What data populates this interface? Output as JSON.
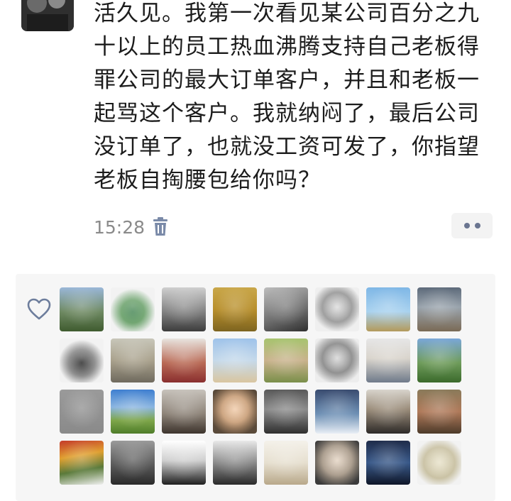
{
  "post": {
    "text_lines": [
      "活久见。我第一次看见某公司百分之九",
      "十以上的员工热血沸腾支持自己老板得",
      "罪公司的最大订单客户，并且和老板一",
      "起骂这个客户。我就纳闷了，最后公司",
      "没订单了，也就没工资可发了，你指望",
      "老板自掏腰包给你吗？"
    ],
    "timestamp": "15:28"
  },
  "icons": {
    "delete": "trash-icon",
    "more": "more-dots-icon",
    "like": "heart-outline-icon"
  },
  "colors": {
    "text": "#1c1c1c",
    "timestamp": "#8a8a8a",
    "panel_bg": "#f6f6f6",
    "dots": "#6a7590"
  },
  "likers": [
    {
      "bg": "linear-gradient(180deg,#9ab7d8 0%,#6f8a63 55%,#3f5b2f 100%)"
    },
    {
      "bg": "radial-gradient(circle at 50% 55%,#4c8a5a 0%,#6da36d 35%,#f2f2f2 70%)"
    },
    {
      "bg": "linear-gradient(180deg,#cfcfcf 0%,#7b7b7b 60%,#3c3c3c 100%)"
    },
    {
      "bg": "linear-gradient(180deg,#c9a74a 0%,#b88f2c 50%,#7d6420 100%)"
    },
    {
      "bg": "linear-gradient(160deg,#bdbdbd 0%,#6d6d6d 60%,#2f2f2f 100%)"
    },
    {
      "bg": "radial-gradient(circle at 50% 45%,#dcdcdc 0%,#9a9a9a 45%,#efefef 75%)"
    },
    {
      "bg": "linear-gradient(180deg,#7fb7e6 0%,#a9d2ef 55%,#b39a5b 100%)"
    },
    {
      "bg": "linear-gradient(180deg,#5d6a7a 0%,#9aa4ad 45%,#7a6a55 100%)"
    },
    {
      "bg": "radial-gradient(circle at 50% 55%,#2c2c2c 0%,#8a8a8a 40%,#f2f2f2 70%)"
    },
    {
      "bg": "linear-gradient(180deg,#c8c6b9 0%,#a9a18c 50%,#6f6a5e 100%)"
    },
    {
      "bg": "linear-gradient(180deg,#e8e4df 0%,#b96a55 55%,#8a2f2f 100%)"
    },
    {
      "bg": "linear-gradient(180deg,#9fc3ea 0%,#c5d9ea 50%,#d9c6a0 100%)"
    },
    {
      "bg": "linear-gradient(180deg,#a7c46f 0%,#c9b28c 50%,#7a8f4a 100%)"
    },
    {
      "bg": "radial-gradient(circle at 50% 45%,#d5d5d5 0%,#8c8c8c 45%,#ededed 80%)"
    },
    {
      "bg": "linear-gradient(180deg,#e6e6e6 0%,#d9d4cc 45%,#6f7a8a 100%)"
    },
    {
      "bg": "linear-gradient(180deg,#7aa7d8 0%,#6f9c5b 55%,#3b6a2c 100%)"
    },
    {
      "bg": "linear-gradient(180deg,#9a9a9a 0%,#8a8a8a 100%)"
    },
    {
      "bg": "linear-gradient(180deg,#3f7fd0 0%,#8ab5e0 40%,#7ea64a 70%,#4f7d2a 100%)"
    },
    {
      "bg": "linear-gradient(180deg,#c7c2bb 0%,#8d8378 55%,#3d342d 100%)"
    },
    {
      "bg": "radial-gradient(circle at 50% 45%,#f0c9a6 0%,#caa07a 40%,#5a4a3a 80%)"
    },
    {
      "bg": "linear-gradient(180deg,#5a5a5a 0%,#8c8c8c 45%,#2f2f2f 100%)"
    },
    {
      "bg": "linear-gradient(180deg,#3a4c70 0%,#6d8fb4 55%,#e8eef5 100%)"
    },
    {
      "bg": "linear-gradient(180deg,#d8d4cc 0%,#9a8c7a 45%,#2d2a28 100%)"
    },
    {
      "bg": "linear-gradient(180deg,#8a7a5a 0%,#b07a5a 50%,#4d3b2a 100%)"
    },
    {
      "bg": "linear-gradient(170deg,#c43a2a 0%,#e0a030 35%,#5a7a3a 65%,#f0f0f0 100%)"
    },
    {
      "bg": "linear-gradient(180deg,#9a9a9a 0%,#5a5a5a 55%,#2a2a2a 100%)"
    },
    {
      "bg": "linear-gradient(180deg,#ffffff 0%,#cfcfcf 45%,#1f1f1f 100%)"
    },
    {
      "bg": "linear-gradient(180deg,#e8e8e8 0%,#8a8a8a 50%,#2a2a2a 100%)"
    },
    {
      "bg": "linear-gradient(180deg,#f4f1ea 0%,#e6dfcf 50%,#b8a88a 100%)"
    },
    {
      "bg": "radial-gradient(circle at 50% 45%,#e3d2c0 0%,#a89a8a 45%,#3b3b3b 85%)"
    },
    {
      "bg": "linear-gradient(180deg,#1f2c4a 0%,#3a5a8a 50%,#0f1628 100%)"
    },
    {
      "bg": "radial-gradient(circle at 50% 50%,#e8e2c9 0%,#c9c1a3 50%,#f2f2f2 80%)"
    }
  ]
}
